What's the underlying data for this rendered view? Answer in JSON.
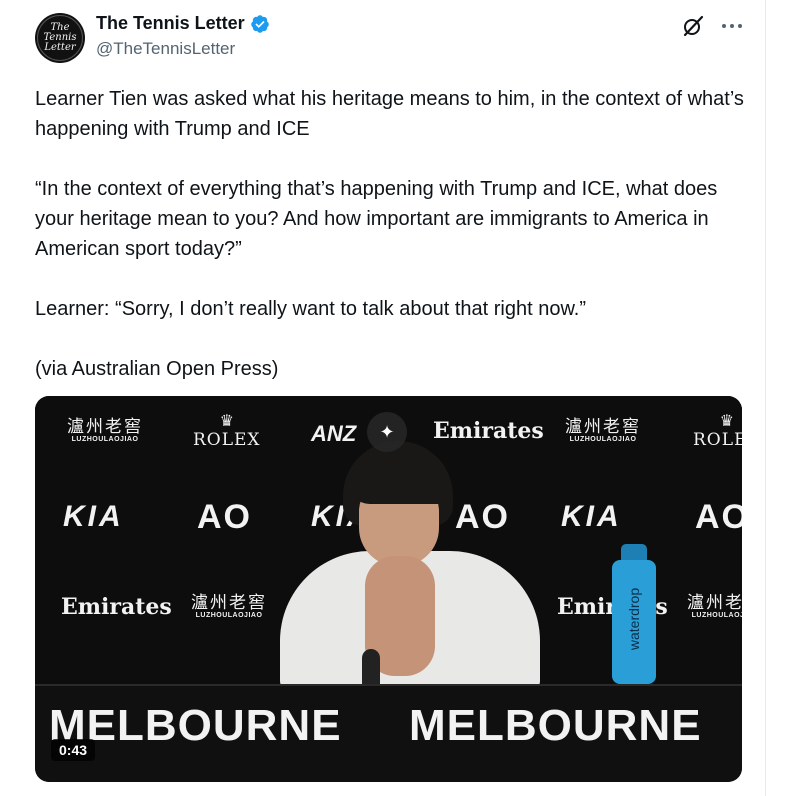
{
  "author": {
    "display_name": "The Tennis Letter",
    "handle": "@TheTennisLetter",
    "avatar_lines": [
      "The",
      "Tennis",
      "Letter"
    ],
    "verified_color": "#1d9bf0"
  },
  "tweet": {
    "paragraphs": [
      "Learner Tien was asked what his heritage means to him, in the context of what’s happening with Trump and ICE",
      "“In the context of everything that’s happening with Trump and ICE, what does your heritage mean to you? And how important are immigrants to America in American sport today?”",
      "Learner: “Sorry, I don’t really want to talk about that right now.”",
      "(via Australian Open Press)"
    ]
  },
  "media": {
    "type": "video",
    "duration": "0:43",
    "sponsors": {
      "luzhoulaojiao_cn": "瀘州老窖",
      "luzhoulaojiao_en": "LUZHOULAOJIAO",
      "rolex": "ROLEX",
      "anz": "ANZ",
      "emirates": "Emirates",
      "kia": "KIA",
      "ao": "AO",
      "melbourne": "MELBOURNE",
      "waterdrop": "waterdrop"
    }
  },
  "icons": {
    "grok": "grok-icon",
    "more": "more-icon",
    "verified": "verified-badge-icon",
    "sparkle": "sparkle-icon"
  }
}
